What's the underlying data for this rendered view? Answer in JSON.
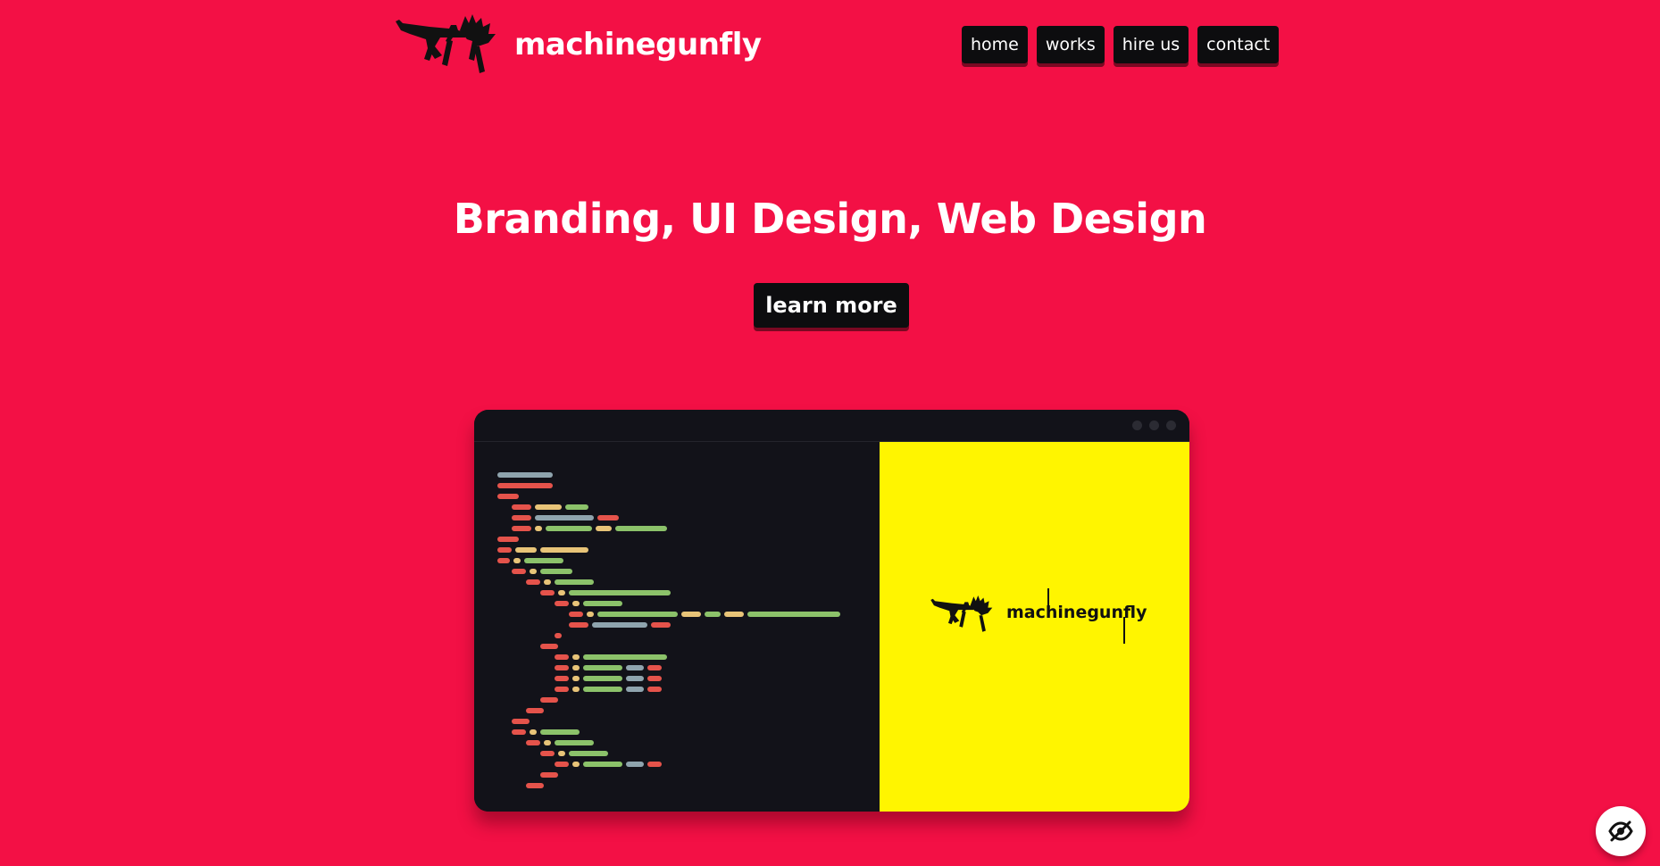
{
  "header": {
    "brand": "machinegunfly",
    "nav": [
      {
        "label": "home"
      },
      {
        "label": "works"
      },
      {
        "label": "hire us"
      },
      {
        "label": "contact"
      }
    ]
  },
  "hero": {
    "title": "Branding, UI Design, Web Design",
    "cta_label": "learn more"
  },
  "mockup": {
    "preview_brand": "machinegunfly",
    "preview_background": "#fff500"
  },
  "colors": {
    "page_background": "#f31045",
    "button_background": "#0d0d0f",
    "window_background": "#121219",
    "code_red": "#e5534b",
    "code_green": "#8cc26a",
    "code_yellow": "#e8c478",
    "code_gray": "#8fa4ae"
  },
  "icons": {
    "logo": "machine-gun-with-wings-icon",
    "fab": "eye-off-icon"
  }
}
